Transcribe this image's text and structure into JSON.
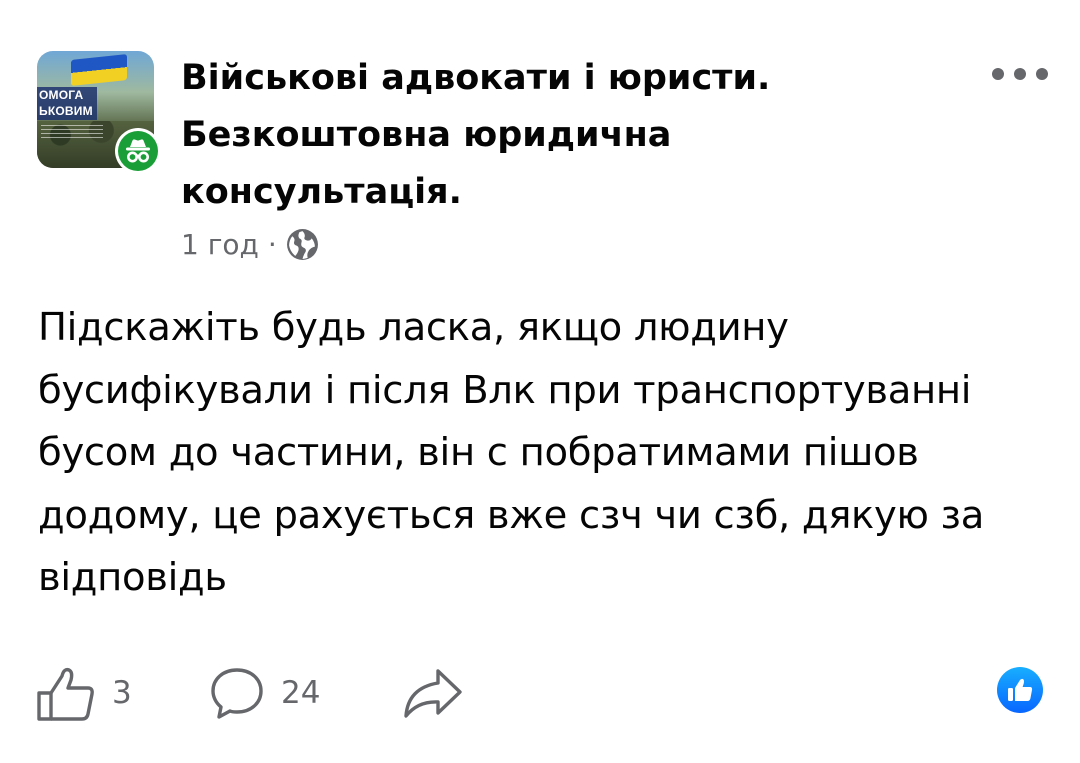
{
  "header": {
    "group_name_line1": "Військові адвокати і юристи.",
    "group_name_line2": "Безкоштовна юридична",
    "group_name_line3": "консультація.",
    "avatar_text_line1": "ОМОГА",
    "avatar_text_line2": "ЬКОВИМ",
    "timestamp": "1 год",
    "separator": "·",
    "privacy_icon": "globe-icon",
    "anonymous_badge_icon": "anonymous-incognito-icon",
    "more_icon": "more-horizontal-icon"
  },
  "post": {
    "text": "Підскажіть будь ласка, якщо людину бусифікували і після Влк при транспортуванні бусом до частини, він с побратимами пішов додому, це рахується вже сзч чи сзб, дякую за відповідь"
  },
  "actions": {
    "like_icon": "thumbs-up-outline-icon",
    "like_count": "3",
    "comment_icon": "comment-bubble-icon",
    "comment_count": "24",
    "share_icon": "share-arrow-icon",
    "reaction_icon": "like-reaction-icon"
  },
  "colors": {
    "text_primary": "#050505",
    "text_secondary": "#65676b",
    "anon_badge_green": "#1a9e37",
    "like_blue": "#0866ff"
  }
}
